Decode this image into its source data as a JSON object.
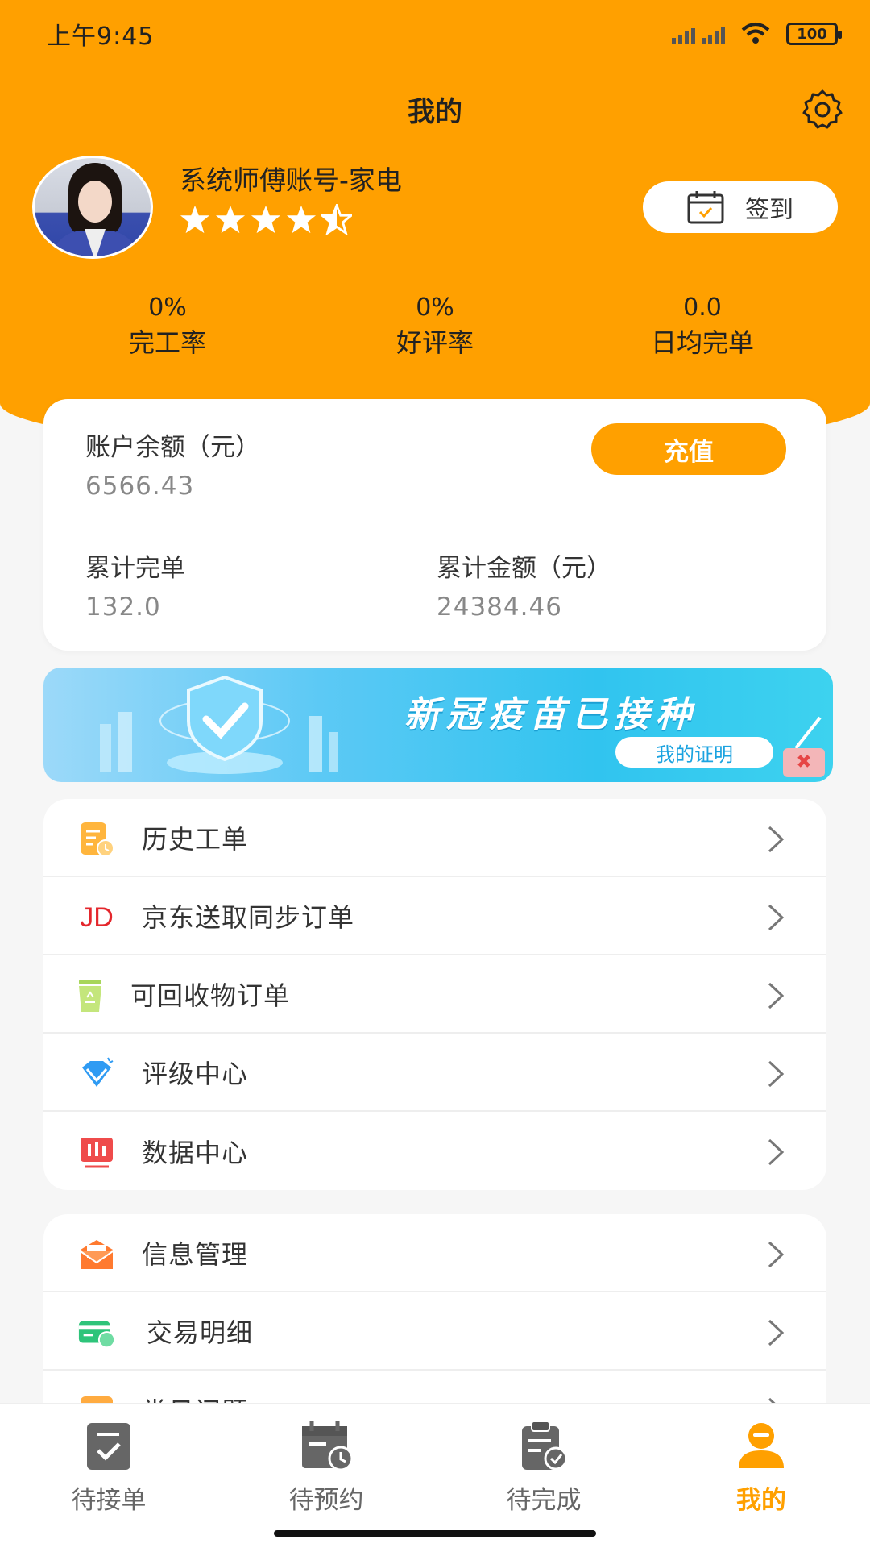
{
  "status": {
    "time": "上午9:45",
    "battery": "100"
  },
  "header": {
    "title": "我的"
  },
  "profile": {
    "name": "系统师傅账号-家电",
    "rating": 4.5,
    "checkin_label": "签到"
  },
  "stats": [
    {
      "value": "0%",
      "label": "完工率"
    },
    {
      "value": "0%",
      "label": "好评率"
    },
    {
      "value": "0.0",
      "label": "日均完单"
    }
  ],
  "account": {
    "balance_label": "账户余额（元）",
    "balance": "6566.43",
    "recharge_label": "充值",
    "total_orders_label": "累计完单",
    "total_orders": "132.0",
    "total_amount_label": "累计金额（元）",
    "total_amount": "24384.46"
  },
  "banner": {
    "title": "新冠疫苗已接种",
    "button": "我的证明"
  },
  "menu_group_1": [
    {
      "icon": "history-order-icon",
      "label": "历史工单"
    },
    {
      "icon": "jd-icon",
      "label": "京东送取同步订单",
      "icon_text": "JD"
    },
    {
      "icon": "recycle-bin-icon",
      "label": "可回收物订单"
    },
    {
      "icon": "diamond-icon",
      "label": "评级中心"
    },
    {
      "icon": "data-chart-icon",
      "label": "数据中心"
    }
  ],
  "menu_group_2": [
    {
      "icon": "mail-icon",
      "label": "信息管理"
    },
    {
      "icon": "card-icon",
      "label": "交易明细"
    },
    {
      "icon": "help-icon",
      "label": "常见问题"
    }
  ],
  "tabs": [
    {
      "icon": "accept-order-icon",
      "label": "待接单"
    },
    {
      "icon": "calendar-clock-icon",
      "label": "待预约"
    },
    {
      "icon": "clipboard-check-icon",
      "label": "待完成"
    },
    {
      "icon": "user-icon",
      "label": "我的",
      "active": true
    }
  ],
  "colors": {
    "primary": "#ffa000",
    "background": "#f6f6f6"
  }
}
